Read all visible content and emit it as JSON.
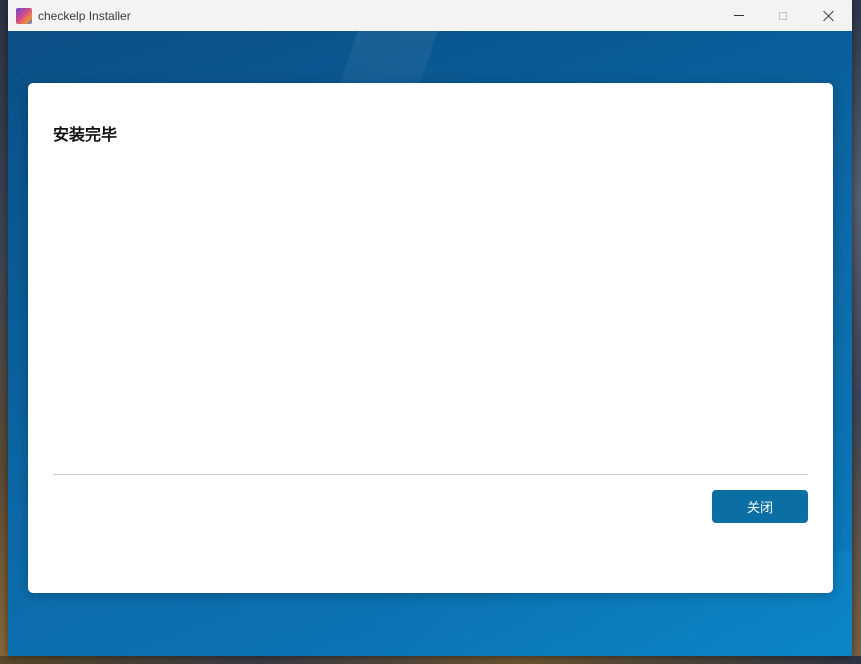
{
  "window": {
    "title": "checkelp Installer"
  },
  "icons": {
    "app": "app-icon",
    "minimize": "minimize-icon",
    "maximize": "maximize-icon",
    "close": "close-icon"
  },
  "card": {
    "heading": "安装完毕",
    "close_button_label": "关闭"
  },
  "colors": {
    "accent": "#0b6fa3",
    "background": "#0a64a4",
    "card": "#ffffff"
  }
}
